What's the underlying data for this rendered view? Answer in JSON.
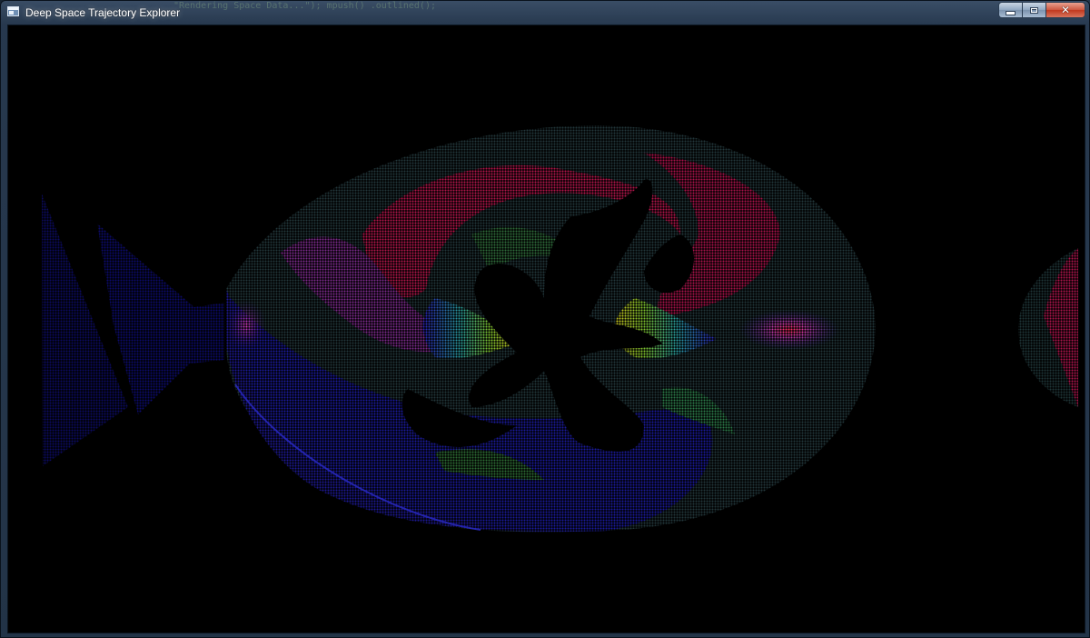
{
  "window": {
    "title": "Deep Space Trajectory Explorer",
    "background_code_snippet": "\"Rendering Space Data...\");   mpush()   .outlined();",
    "app_icon": "window-app-icon",
    "buttons": {
      "minimize_icon": "minimize-icon",
      "maximize_icon": "maximize-icon",
      "close_icon": "close-icon",
      "close_glyph": "✕"
    }
  },
  "viewport": {
    "background_color": "#000000",
    "colors": {
      "red": "#c8184a",
      "magenta": "#c03aa8",
      "blue": "#2a22b8",
      "deep_blue": "#0c0a60",
      "green": "#3a9a3a",
      "yellow": "#c8c020",
      "teal": "#2c4a48"
    }
  }
}
